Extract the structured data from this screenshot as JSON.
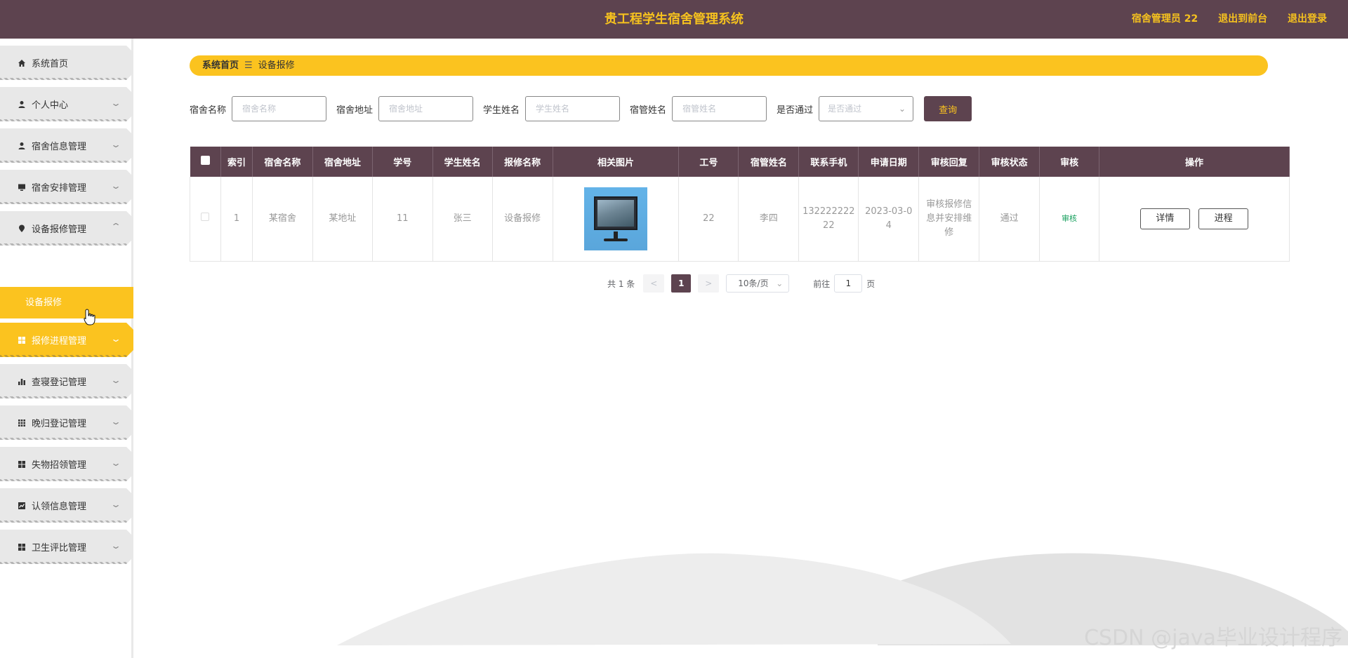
{
  "header": {
    "title": "贵工程学生宿舍管理系统",
    "user": "宿舍管理员 22",
    "to_front": "退出到前台",
    "logout": "退出登录"
  },
  "sidebar": {
    "items": [
      {
        "label": "系统首页",
        "icon": "home-icon"
      },
      {
        "label": "个人中心",
        "icon": "user-icon"
      },
      {
        "label": "宿舍信息管理",
        "icon": "user-icon"
      },
      {
        "label": "宿舍安排管理",
        "icon": "monitor-icon"
      },
      {
        "label": "设备报修管理",
        "icon": "location-icon"
      },
      {
        "label": "报修进程管理",
        "icon": "grid-icon"
      },
      {
        "label": "查寝登记管理",
        "icon": "bar-chart-icon"
      },
      {
        "label": "晚归登记管理",
        "icon": "apps-icon"
      },
      {
        "label": "失物招领管理",
        "icon": "grid-icon"
      },
      {
        "label": "认领信息管理",
        "icon": "trend-icon"
      },
      {
        "label": "卫生评比管理",
        "icon": "grid-icon"
      }
    ],
    "submenu_label": "设备报修"
  },
  "breadcrumb": {
    "home": "系统首页",
    "separator": "☰",
    "current": "设备报修"
  },
  "search": {
    "dorm_name_label": "宿舍名称",
    "dorm_name_placeholder": "宿舍名称",
    "dorm_addr_label": "宿舍地址",
    "dorm_addr_placeholder": "宿舍地址",
    "student_name_label": "学生姓名",
    "student_name_placeholder": "学生姓名",
    "manager_name_label": "宿管姓名",
    "manager_name_placeholder": "宿管姓名",
    "passed_label": "是否通过",
    "passed_placeholder": "是否通过",
    "query_button": "查询"
  },
  "table": {
    "headers": [
      "索引",
      "宿舍名称",
      "宿舍地址",
      "学号",
      "学生姓名",
      "报修名称",
      "相关图片",
      "工号",
      "宿管姓名",
      "联系手机",
      "申请日期",
      "审核回复",
      "审核状态",
      "审核",
      "操作"
    ],
    "rows": [
      {
        "index": "1",
        "dorm_name": "某宿舍",
        "dorm_addr": "某地址",
        "student_no": "11",
        "student_name": "张三",
        "repair_name": "设备报修",
        "staff_no": "22",
        "manager_name": "李四",
        "phone": "132222222 22",
        "apply_date": "2023-03-0 4",
        "reply": "审核报修信 息并安排维 修",
        "status": "通过",
        "audit_link": "审核",
        "detail_button": "详情",
        "progress_button": "进程"
      }
    ]
  },
  "pagination": {
    "total": "共 1 条",
    "prev": "<",
    "current_page": "1",
    "next": ">",
    "page_size": "10条/页",
    "goto_label": "前往",
    "goto_value": "1",
    "page_unit": "页"
  },
  "watermark": "CSDN @java毕业设计程序",
  "colors": {
    "header_bg": "#5d434f",
    "accent": "#fbc31f",
    "audit_green": "#19a15f"
  }
}
